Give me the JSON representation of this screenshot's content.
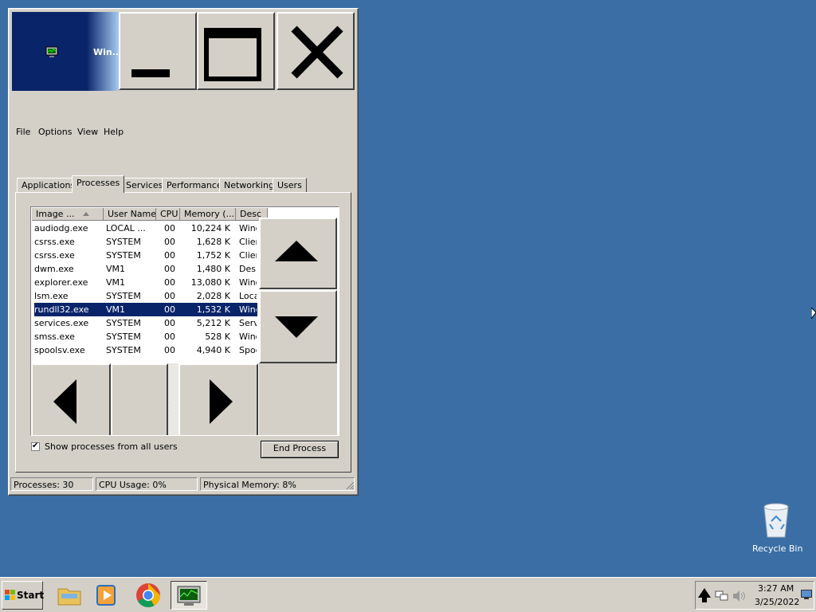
{
  "window": {
    "title": "Win...",
    "menu": [
      "File",
      "Options",
      "View",
      "Help"
    ],
    "tabs": [
      "Applications",
      "Processes",
      "Services",
      "Performance",
      "Networking",
      "Users"
    ],
    "active_tab": "Processes"
  },
  "process_list": {
    "columns": [
      "Image ...",
      "User Name",
      "CPU",
      "Memory (...",
      "Desc"
    ],
    "rows": [
      {
        "image": "audiodg.exe",
        "user": "LOCAL ...",
        "cpu": "00",
        "memory": "10,224 K",
        "desc": "Wind"
      },
      {
        "image": "csrss.exe",
        "user": "SYSTEM",
        "cpu": "00",
        "memory": "1,628 K",
        "desc": "Clier"
      },
      {
        "image": "csrss.exe",
        "user": "SYSTEM",
        "cpu": "00",
        "memory": "1,752 K",
        "desc": "Clier"
      },
      {
        "image": "dwm.exe",
        "user": "VM1",
        "cpu": "00",
        "memory": "1,480 K",
        "desc": "Desk"
      },
      {
        "image": "explorer.exe",
        "user": "VM1",
        "cpu": "00",
        "memory": "13,080 K",
        "desc": "Wind"
      },
      {
        "image": "lsm.exe",
        "user": "SYSTEM",
        "cpu": "00",
        "memory": "2,028 K",
        "desc": "Loca"
      },
      {
        "image": "rundll32.exe",
        "user": "VM1",
        "cpu": "00",
        "memory": "1,532 K",
        "desc": "Wind"
      },
      {
        "image": "services.exe",
        "user": "SYSTEM",
        "cpu": "00",
        "memory": "5,212 K",
        "desc": "Serv"
      },
      {
        "image": "smss.exe",
        "user": "SYSTEM",
        "cpu": "00",
        "memory": "528 K",
        "desc": "Wind"
      },
      {
        "image": "spoolsv.exe",
        "user": "SYSTEM",
        "cpu": "00",
        "memory": "4,940 K",
        "desc": "Spoo"
      }
    ],
    "selected_image": "rundll32.exe"
  },
  "show_all_users": {
    "label": "Show processes from all users",
    "checked": true,
    "mark": "✔"
  },
  "end_process_label": "End Process",
  "status_bar": {
    "processes": "Processes: 30",
    "cpu": "CPU Usage: 0%",
    "memory": "Physical Memory: 8%"
  },
  "desktop": {
    "recycle_bin_label": "Recycle Bin"
  },
  "taskbar": {
    "start_label": "Start",
    "time": "3:27 AM",
    "date": "3/25/2022"
  },
  "colors": {
    "desktop": "#3a6ea5",
    "selection": "#0a246a",
    "face": "#d4d0c8"
  }
}
